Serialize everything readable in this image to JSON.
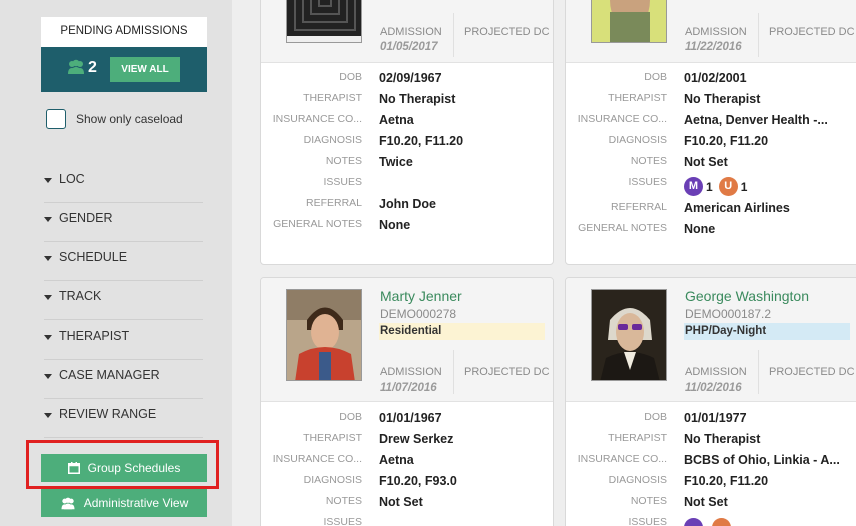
{
  "pending": {
    "title": "PENDING ADMISSIONS",
    "count": "2",
    "view_all": "VIEW ALL",
    "icon": "users-icon"
  },
  "caseload": {
    "label": "Show only caseload"
  },
  "filters": [
    "LOC",
    "GENDER",
    "SCHEDULE",
    "TRACK",
    "THERAPIST",
    "CASE MANAGER",
    "REVIEW RANGE"
  ],
  "buttons": {
    "group_schedules": "Group Schedules",
    "administrative_view": "Administrative View"
  },
  "labels": {
    "admission": "ADMISSION",
    "projected_dc": "PROJECTED DC",
    "dob": "DOB",
    "therapist": "THERAPIST",
    "insurance": "INSURANCE CO...",
    "diagnosis": "DIAGNOSIS",
    "notes": "NOTES",
    "issues": "ISSUES",
    "referral": "REFERRAL",
    "general_notes": "GENERAL NOTES"
  },
  "cards": [
    {
      "admission": "01/05/2017",
      "dob": "02/09/1967",
      "therapist": "No Therapist",
      "insurance": "Aetna",
      "diagnosis": "F10.20, F11.20",
      "notes": "Twice",
      "referral": "John Doe",
      "general_notes": "None"
    },
    {
      "admission": "11/22/2016",
      "dob": "01/02/2001",
      "therapist": "No Therapist",
      "insurance": "Aetna, Denver Health -...",
      "diagnosis": "F10.20, F11.20",
      "notes": "Not Set",
      "issues": [
        {
          "letter": "M",
          "count": "1",
          "color": "#6a3fb5"
        },
        {
          "letter": "U",
          "count": "1",
          "color": "#e07a45"
        }
      ],
      "referral": "American Airlines",
      "general_notes": "None"
    },
    {
      "name": "Marty Jenner",
      "id": "DEMO000278",
      "program": "Residential",
      "program_color": "#fcf3d3",
      "admission": "11/07/2016",
      "dob": "01/01/1967",
      "therapist": "Drew Serkez",
      "insurance": "Aetna",
      "diagnosis": "F10.20, F93.0",
      "notes": "Not Set"
    },
    {
      "name": "George Washington",
      "id": "DEMO000187.2",
      "program": "PHP/Day-Night",
      "program_color": "#d4eaf5",
      "admission": "11/02/2016",
      "dob": "01/01/1977",
      "therapist": "No Therapist",
      "insurance": "BCBS of Ohio, Linkia - A...",
      "diagnosis": "F10.20, F11.20",
      "notes": "Not Set"
    }
  ]
}
